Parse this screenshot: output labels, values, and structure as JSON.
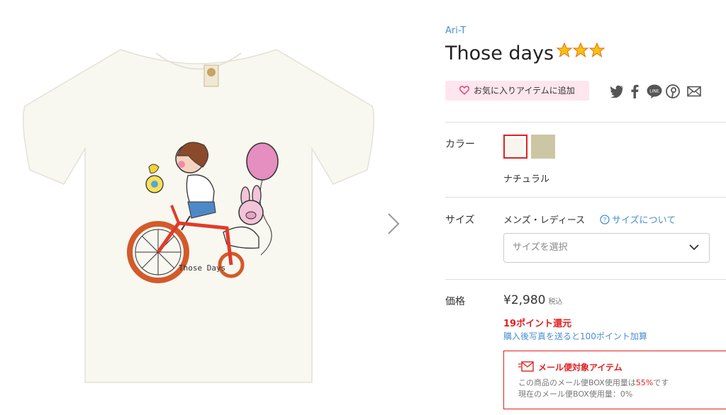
{
  "product": {
    "shop_name": "Ari-T",
    "title": "Those days",
    "stars": 3,
    "artwork_caption": "Those Days"
  },
  "actions": {
    "favorite_label": "お気に入りアイテムに追加",
    "share_icons": [
      "twitter-icon",
      "facebook-icon",
      "line-icon",
      "pinterest-icon",
      "mail-icon"
    ]
  },
  "color": {
    "label": "カラー",
    "selected_name": "ナチュラル",
    "swatches": [
      "#f7f5ec",
      "#cdc6a4"
    ]
  },
  "size": {
    "label": "サイズ",
    "type": "メンズ・レディース",
    "guide_link": "サイズについて",
    "select_placeholder": "サイズを選択"
  },
  "price": {
    "label": "価格",
    "amount": "¥2,980",
    "tax_note": "税込",
    "points": "19ポイント還元",
    "photo_bonus": "購入後写真を送ると100ポイント加算"
  },
  "mail_service": {
    "title": "メール便対象アイテム",
    "usage_prefix": "この商品のメール便BOX使用量は",
    "usage_percent": "55%",
    "usage_suffix": "です",
    "current_usage": "現在のメール便BOX使用量：0%"
  },
  "colors": {
    "accent_red": "#e02020",
    "link_blue": "#4a8fd0",
    "fav_bg": "#fde6ee"
  }
}
